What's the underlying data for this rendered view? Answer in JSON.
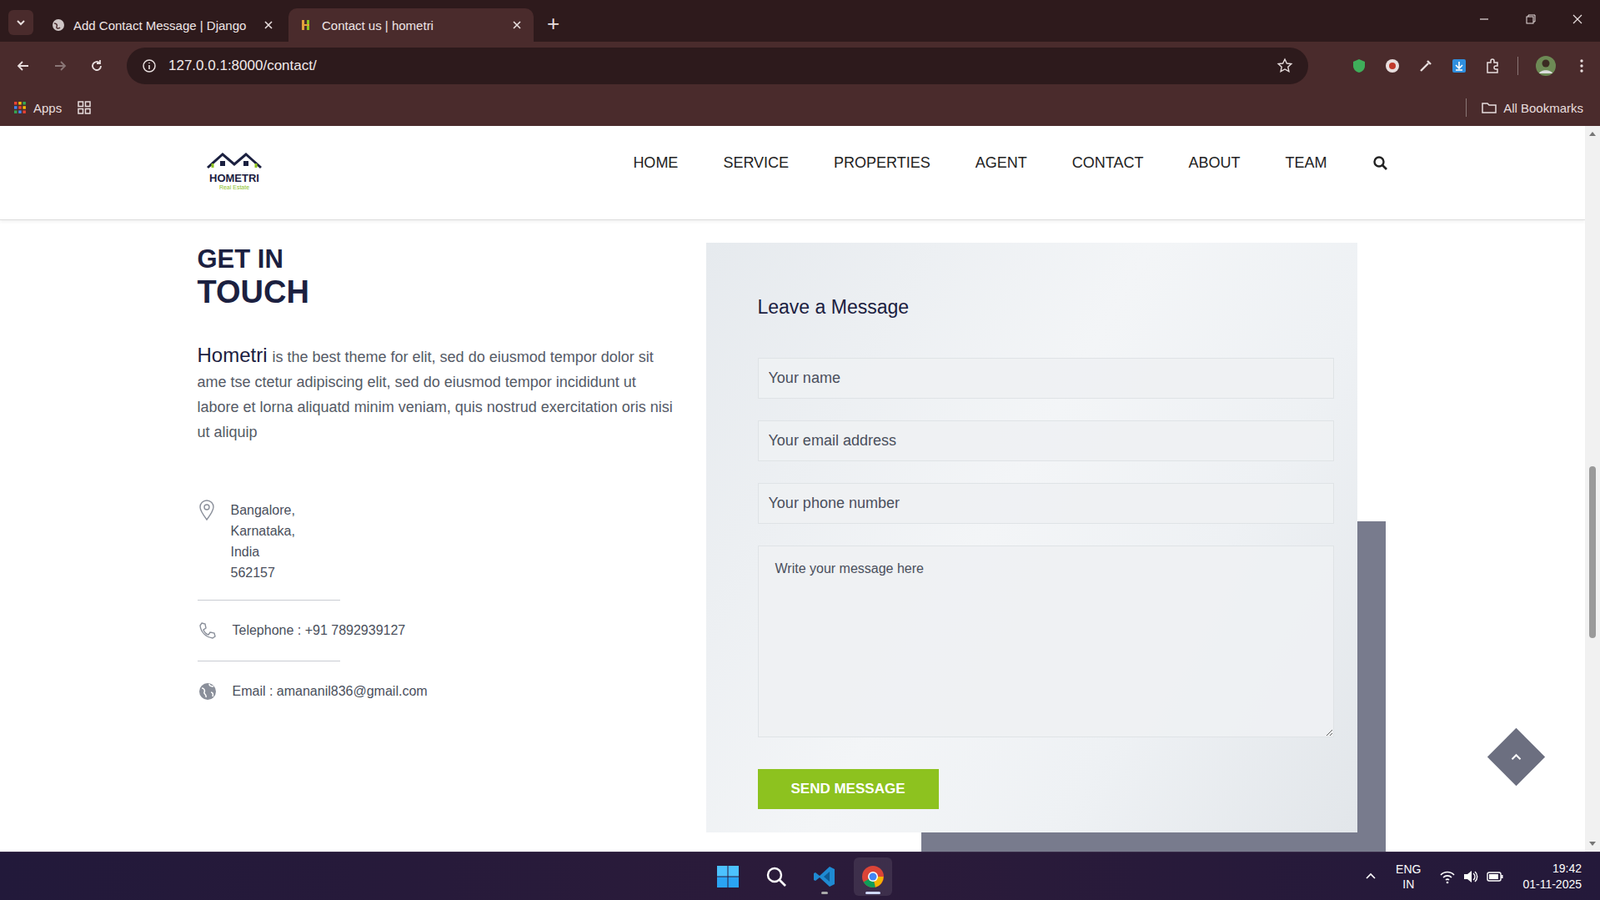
{
  "browser": {
    "tabs": [
      {
        "title": "Add Contact Message | Django",
        "selected": false
      },
      {
        "title": "Contact us | hometri",
        "selected": true
      }
    ],
    "new_tab": "+",
    "url": "127.0.0.1:8000/contact/",
    "back_enabled": true,
    "forward_enabled": false,
    "bookmarks": [
      {
        "label": "Apps"
      }
    ],
    "all_bookmarks": "All Bookmarks"
  },
  "site": {
    "logo": {
      "name": "HOMETRI",
      "tagline": "Real Estate"
    },
    "nav": [
      {
        "label": "HOME"
      },
      {
        "label": "SERVICE"
      },
      {
        "label": "PROPERTIES"
      },
      {
        "label": "AGENT"
      },
      {
        "label": "CONTACT"
      },
      {
        "label": "ABOUT"
      },
      {
        "label": "TEAM"
      }
    ],
    "contact": {
      "heading": [
        "GET IN",
        "TOUCH"
      ],
      "brand": "Hometri",
      "intro": "is the best theme for elit, sed do eiusmod tempor dolor sit ame tse ctetur adipiscing elit, sed do eiusmod tempor incididunt ut labore et lorna aliquatd minim veniam, quis nostrud exercitation oris nisi ut aliquip",
      "address": [
        "Bangalore,",
        "Karnataka,",
        "India",
        "562157"
      ],
      "telephone": "Telephone : +91 7892939127",
      "email": "Email : amananil836@gmail.com"
    },
    "form": {
      "title": "Leave a Message",
      "fields": [
        {
          "placeholder": "Your name",
          "kind": "input"
        },
        {
          "placeholder": "Your email address",
          "kind": "input"
        },
        {
          "placeholder": "Your phone number",
          "kind": "input"
        },
        {
          "placeholder": "Write your message here",
          "kind": "textarea"
        }
      ],
      "submit": "SEND MESSAGE"
    }
  },
  "taskbar": {
    "language": [
      "ENG",
      "IN"
    ],
    "time": "19:42",
    "date": "01-11-2025"
  }
}
